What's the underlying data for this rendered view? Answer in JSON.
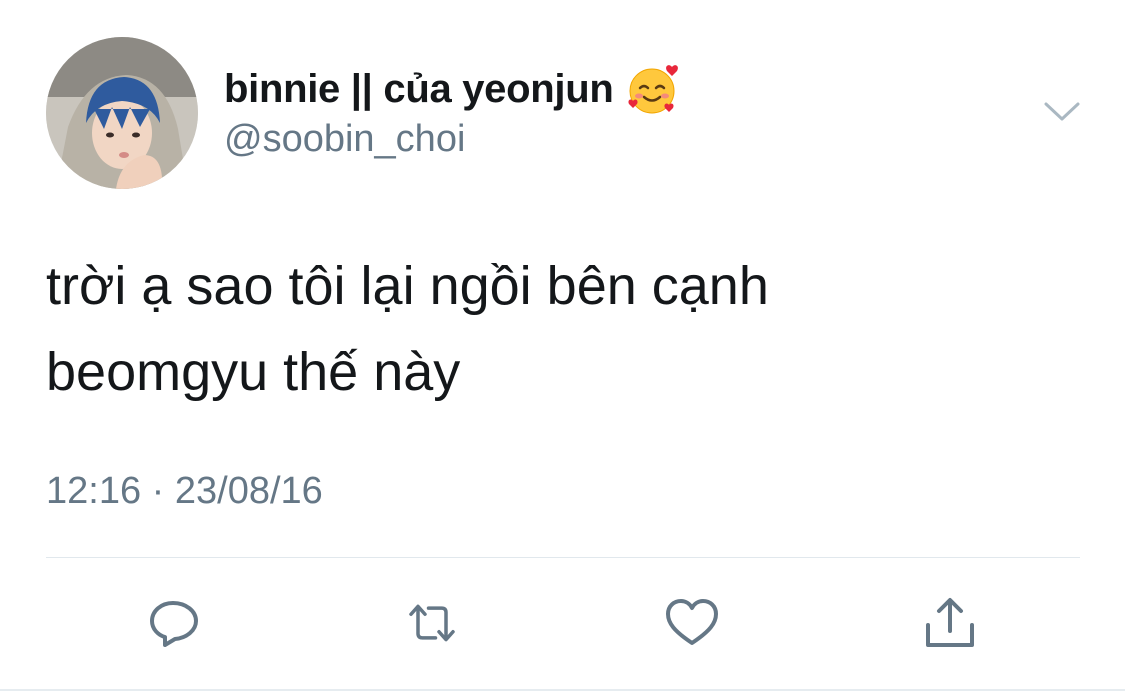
{
  "tweet": {
    "display_name": "binnie || của yeonjun",
    "name_emoji": "smiling-face-with-hearts",
    "handle": "@soobin_choi",
    "text_line1": "trời ạ sao tôi lại ngồi bên cạnh",
    "text_line2": "beomgyu thế này",
    "timestamp": "12:16 · 23/08/16"
  },
  "actions": [
    {
      "name": "reply",
      "icon": "speech-bubble-icon"
    },
    {
      "name": "retweet",
      "icon": "retweet-arrows-icon"
    },
    {
      "name": "like",
      "icon": "heart-outline-icon"
    },
    {
      "name": "share",
      "icon": "share-upload-icon"
    }
  ],
  "colors": {
    "text_primary": "#14171a",
    "text_secondary": "#657786",
    "icon": "#657786",
    "divider": "#e1e8ed",
    "avatar_hair": "#2f5b9e"
  }
}
